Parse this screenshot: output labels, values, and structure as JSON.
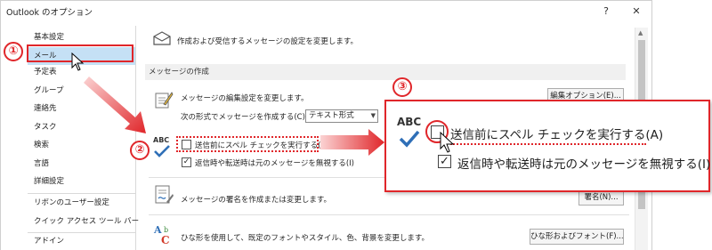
{
  "window": {
    "title": "Outlook のオプション",
    "help_label": "?",
    "close_label": "✕"
  },
  "sidebar": {
    "items": [
      {
        "label": "基本設定"
      },
      {
        "label": "メール"
      },
      {
        "label": "予定表"
      },
      {
        "label": "グループ"
      },
      {
        "label": "連絡先"
      },
      {
        "label": "タスク"
      },
      {
        "label": "検索"
      },
      {
        "label": "言語"
      },
      {
        "label": "詳細設定"
      },
      {
        "label": "リボンのユーザー設定"
      },
      {
        "label": "クイック アクセス ツール バー"
      },
      {
        "label": "アドイン"
      }
    ],
    "selected_index": 1
  },
  "content": {
    "intro": "作成および受信するメッセージの設定を変更します。",
    "section_title": "メッセージの作成",
    "compose_desc": "メッセージの編集設定を変更します。",
    "editor_options_button": "編集オプション(E)...",
    "compose_format_label": "次の形式でメッセージを作成する(C):",
    "compose_format_value": "テキスト形式",
    "spellcheck_label": "送信前にスペル チェックを実行する(A)",
    "spellcheck_checked": false,
    "ignore_original_label": "返信時や転送時は元のメッセージを無視する(I)",
    "ignore_original_checked": true,
    "signature_desc": "メッセージの署名を作成または変更します。",
    "signature_button": "署名(N)...",
    "stationery_desc": "ひな形を使用して、既定のフォントやスタイル、色、背景を変更します。",
    "stationery_button": "ひな形およびフォント(F)...",
    "abc_label": "ABC"
  },
  "callout": {
    "abc_label": "ABC",
    "spellcheck_label": "送信前にスペル チェックを実行する(A)",
    "ignore_original_label": "返信時や転送時は元のメッセージを無視する(I)"
  },
  "annotations": {
    "step1": "①",
    "step2": "②",
    "step3": "③"
  },
  "colors": {
    "accent_red": "#e0262a",
    "selection_blue": "#c5e0f5",
    "checkmark_blue": "#2f6fb7"
  }
}
